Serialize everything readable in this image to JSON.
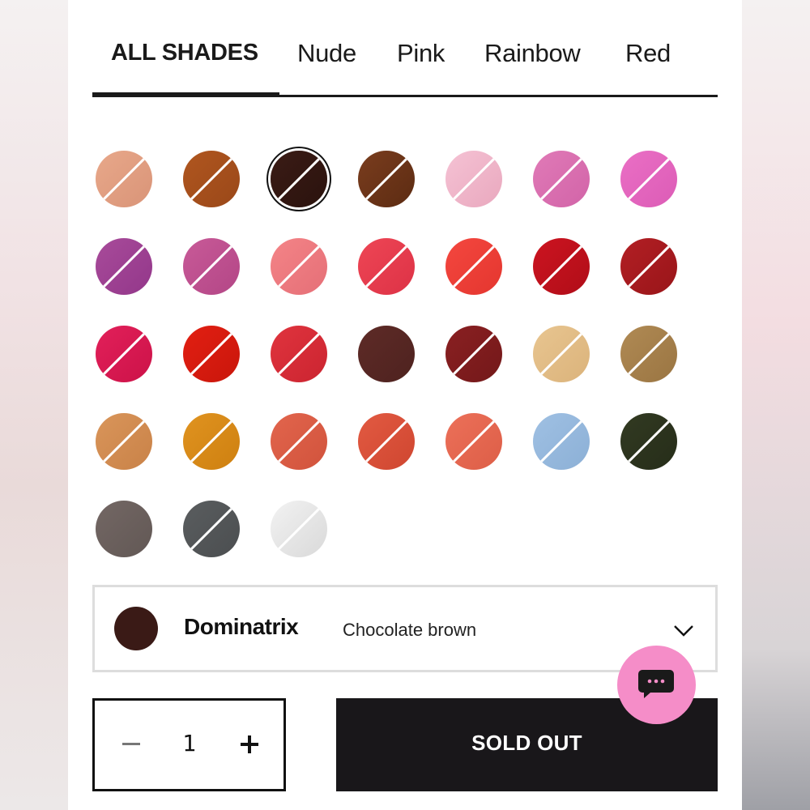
{
  "tabs": [
    {
      "label": "ALL SHADES",
      "active": true
    },
    {
      "label": "Nude"
    },
    {
      "label": "Pink"
    },
    {
      "label": "Rainbow"
    },
    {
      "label": "Red"
    }
  ],
  "swatches": [
    {
      "color": "#e8a88a",
      "color2": "#d99478",
      "slash": true
    },
    {
      "color": "#b0561f",
      "color2": "#9a4819",
      "slash": true
    },
    {
      "color": "#3b1c16",
      "color2": "#2a120d",
      "slash": true,
      "selected": true
    },
    {
      "color": "#7a3d1e",
      "color2": "#5c2b12",
      "slash": true
    },
    {
      "color": "#f5c2d4",
      "color2": "#e9a8be",
      "slash": true
    },
    {
      "color": "#e07ab7",
      "color2": "#d264a8",
      "slash": true
    },
    {
      "color": "#ea6fc5",
      "color2": "#dc5cb6",
      "slash": true
    },
    {
      "color": "#a84b9a",
      "color2": "#93378a",
      "slash": true
    },
    {
      "color": "#c85a98",
      "color2": "#b34686",
      "slash": true
    },
    {
      "color": "#f48487",
      "color2": "#e56f77",
      "slash": true
    },
    {
      "color": "#ee4655",
      "color2": "#dd3246",
      "slash": true
    },
    {
      "color": "#f4473f",
      "color2": "#e4362f",
      "slash": true
    },
    {
      "color": "#cc1420",
      "color2": "#b00d18",
      "slash": true
    },
    {
      "color": "#b21f24",
      "color2": "#991519",
      "slash": true
    },
    {
      "color": "#e2205a",
      "color2": "#cc1248",
      "slash": true
    },
    {
      "color": "#e21f12",
      "color2": "#c9160b",
      "slash": true
    },
    {
      "color": "#e0343e",
      "color2": "#cb2430",
      "slash": true
    },
    {
      "color": "#5e2b27",
      "color2": "#4e221f",
      "slash": false
    },
    {
      "color": "#8a2022",
      "color2": "#731819",
      "slash": true
    },
    {
      "color": "#e8c590",
      "color2": "#dbb37b",
      "slash": true
    },
    {
      "color": "#b08a54",
      "color2": "#9a7542",
      "slash": true
    },
    {
      "color": "#d9955a",
      "color2": "#c98248",
      "slash": true
    },
    {
      "color": "#e09320",
      "color2": "#ce8010",
      "slash": true
    },
    {
      "color": "#e2654d",
      "color2": "#d1533c",
      "slash": true
    },
    {
      "color": "#e25a42",
      "color2": "#cf4630",
      "slash": true
    },
    {
      "color": "#ec7059",
      "color2": "#dd5e47",
      "slash": true
    },
    {
      "color": "#9fc0e3",
      "color2": "#8cb0d6",
      "slash": true
    },
    {
      "color": "#323a22",
      "color2": "#262d19",
      "slash": true
    },
    {
      "color": "#736764",
      "color2": "#625855",
      "slash": false
    },
    {
      "color": "#5a5d5f",
      "color2": "#4b4e50",
      "slash": true
    },
    {
      "color": "#f2f2f2",
      "color2": "#d9d9d9",
      "slash": true
    }
  ],
  "selected_shade": {
    "name": "Dominatrix",
    "description": "Chocolate brown",
    "color": "#3a1a16"
  },
  "quantity": {
    "value": "1"
  },
  "cta": {
    "label": "SOLD OUT"
  },
  "icons": {
    "chevron": "chevron-down-icon",
    "chat": "chat-bubble-icon",
    "minus": "minus-icon",
    "plus": "plus-icon"
  },
  "colors": {
    "accent_chat": "#f58dc8",
    "cta_bg": "#19171a"
  }
}
